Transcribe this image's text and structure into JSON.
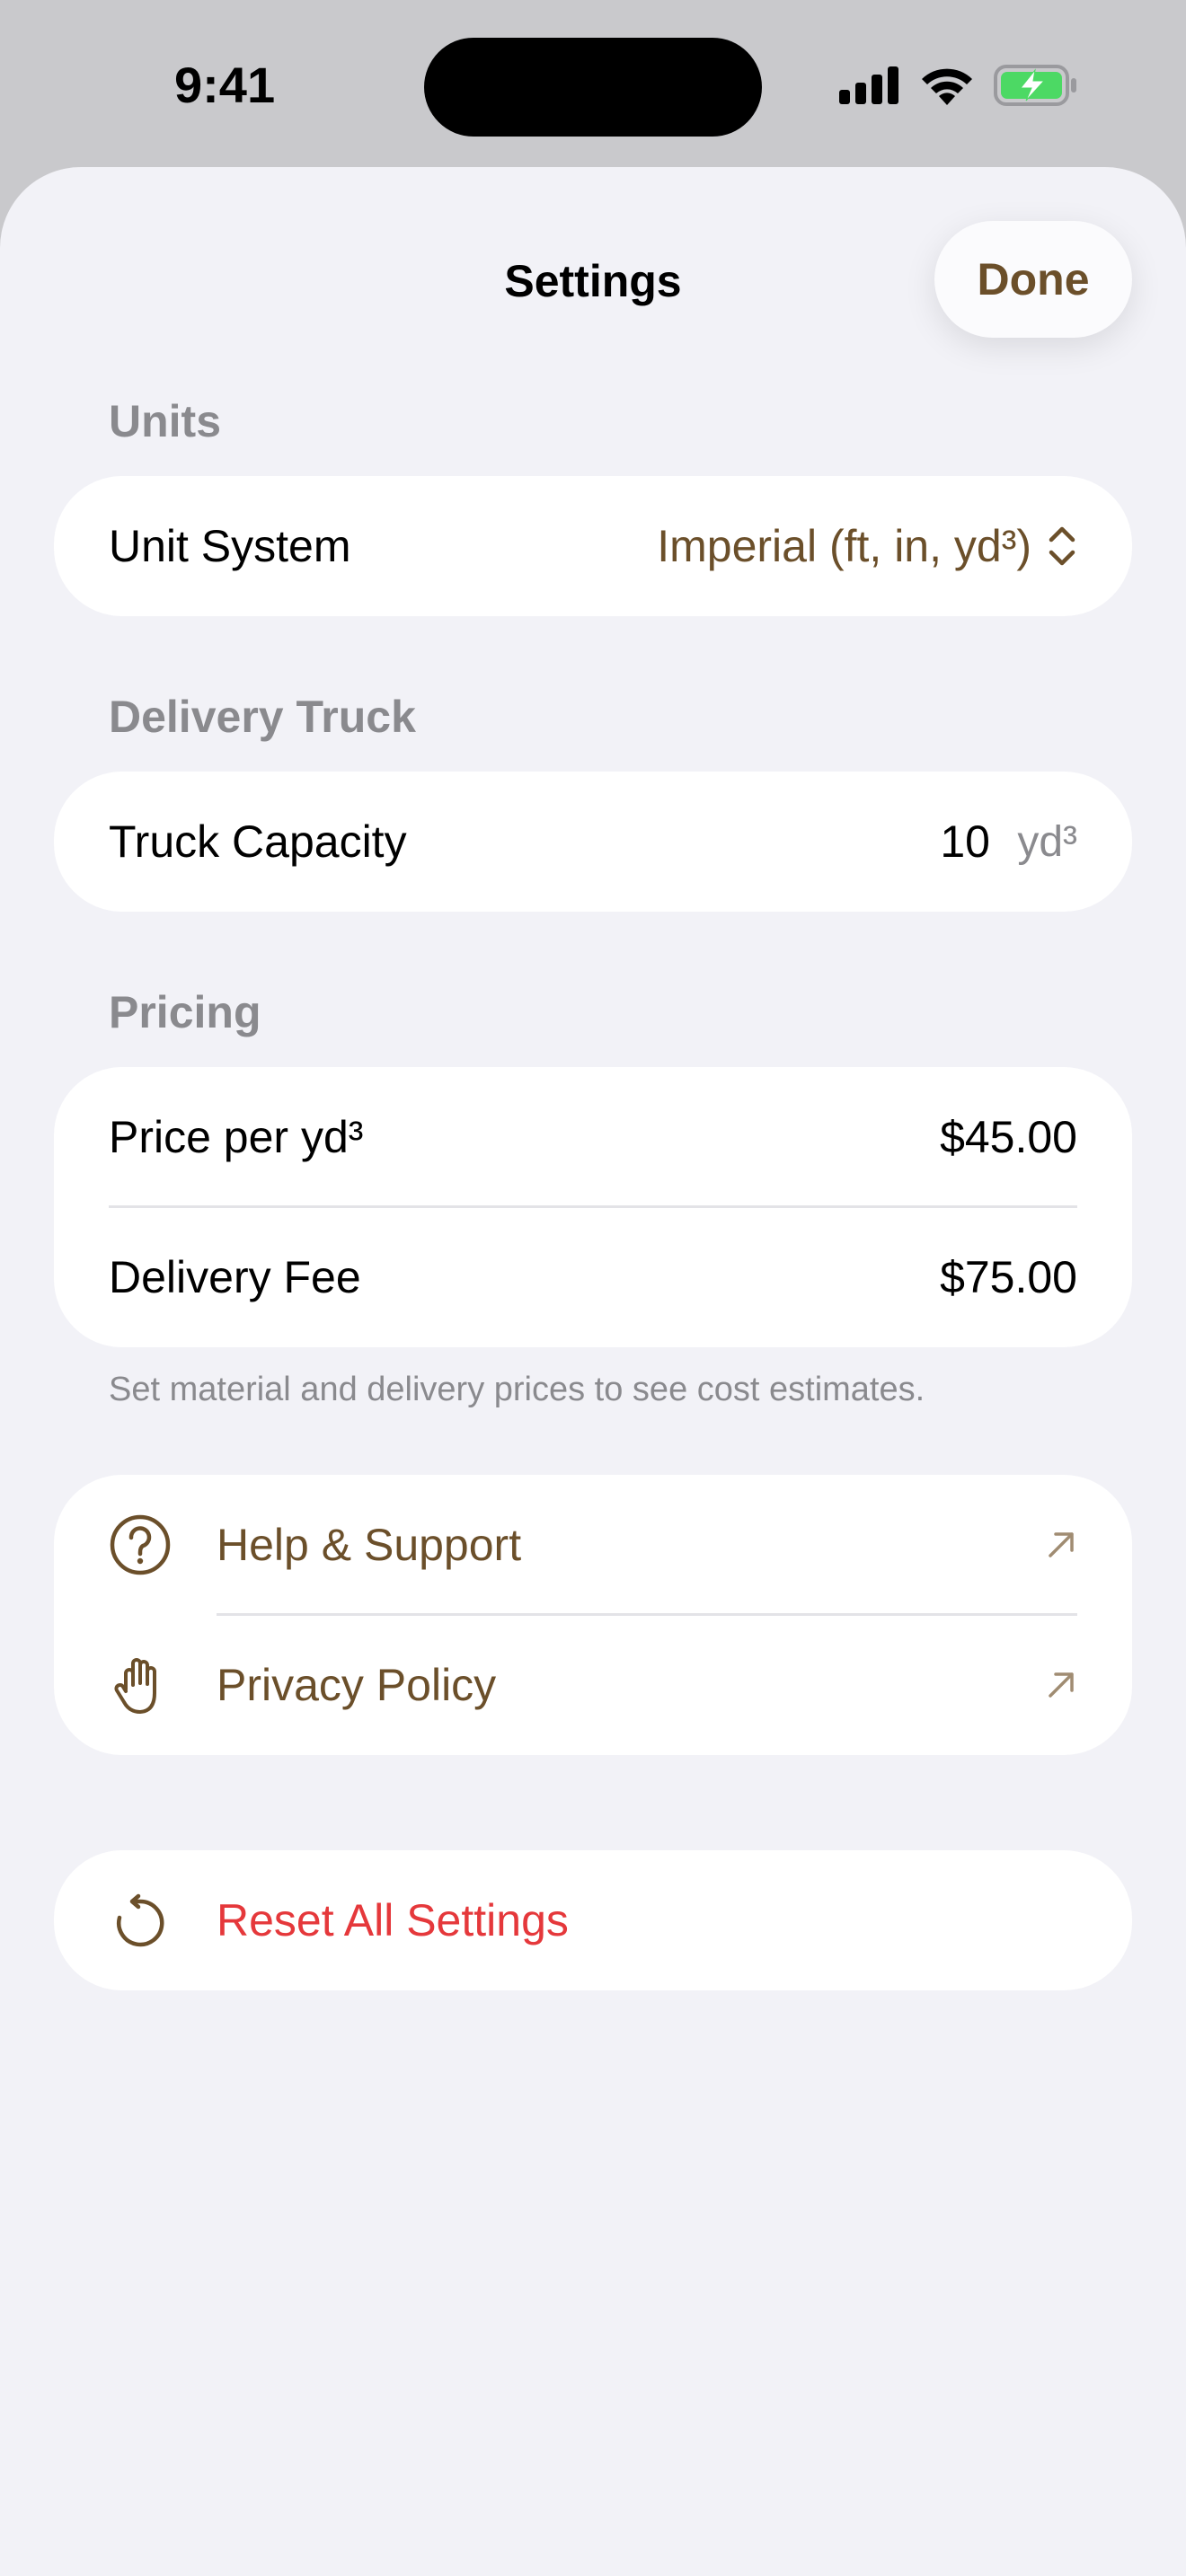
{
  "status_bar": {
    "time": "9:41"
  },
  "nav": {
    "title": "Settings",
    "done_label": "Done"
  },
  "units": {
    "header": "Units",
    "unit_system_label": "Unit System",
    "unit_system_value": "Imperial (ft, in, yd³)"
  },
  "delivery_truck": {
    "header": "Delivery Truck",
    "capacity_label": "Truck Capacity",
    "capacity_value": "10",
    "capacity_unit": "yd³"
  },
  "pricing": {
    "header": "Pricing",
    "price_label": "Price per yd³",
    "price_value": "$45.00",
    "fee_label": "Delivery Fee",
    "fee_value": "$75.00",
    "footnote": "Set material and delivery prices to see cost estimates."
  },
  "links": {
    "help_label": "Help & Support",
    "privacy_label": "Privacy Policy"
  },
  "reset": {
    "label": "Reset All Settings"
  },
  "colors": {
    "accent": "#6b4f2a",
    "destructive": "#e5383b",
    "secondary_text": "#8a8a8e",
    "background": "#f2f2f7"
  }
}
